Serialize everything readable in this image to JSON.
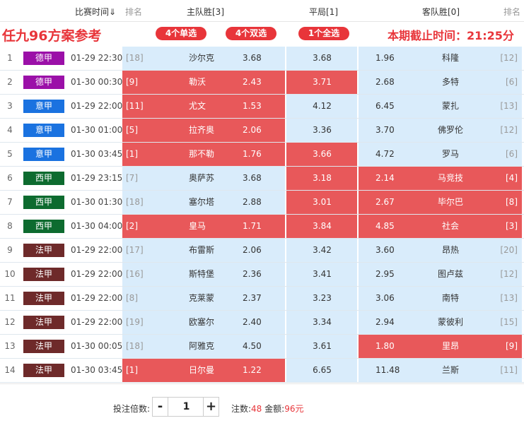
{
  "header": {
    "time_col": "比赛时间⇓",
    "rank_col_left": "排名",
    "home_col": "主队胜[3]",
    "draw_col": "平局[1]",
    "away_col": "客队胜[0]",
    "rank_col_right": "排名"
  },
  "banner": {
    "title": "任九96方案参考",
    "btn_single": "4个单选",
    "btn_double": "4个双选",
    "btn_full": "1个全选",
    "deadline": "本期截止时间：21:25分"
  },
  "colors": {
    "德甲": "#9b10a8",
    "意甲": "#1a72e0",
    "西甲": "#0d6b2f",
    "法甲": "#6e2a2a",
    "selected": "#e8585a",
    "unselected": "#d9ecfb",
    "accent": "#e8353a"
  },
  "matches": [
    {
      "idx": "1",
      "league": "德甲",
      "time": "01-29 22:30",
      "home_rank": "[18]",
      "home": "沙尔克",
      "home_odds": "3.68",
      "draw_odds": "3.68",
      "away_odds": "1.96",
      "away": "科隆",
      "away_rank": "[12]",
      "sel": [
        false,
        false,
        false
      ]
    },
    {
      "idx": "2",
      "league": "德甲",
      "time": "01-30 00:30",
      "home_rank": "[9]",
      "home": "勒沃",
      "home_odds": "2.43",
      "draw_odds": "3.71",
      "away_odds": "2.68",
      "away": "多特",
      "away_rank": "[6]",
      "sel": [
        true,
        true,
        false
      ]
    },
    {
      "idx": "3",
      "league": "意甲",
      "time": "01-29 22:00",
      "home_rank": "[11]",
      "home": "尤文",
      "home_odds": "1.53",
      "draw_odds": "4.12",
      "away_odds": "6.45",
      "away": "蒙扎",
      "away_rank": "[13]",
      "sel": [
        true,
        false,
        false
      ]
    },
    {
      "idx": "4",
      "league": "意甲",
      "time": "01-30 01:00",
      "home_rank": "[5]",
      "home": "拉齐奥",
      "home_odds": "2.06",
      "draw_odds": "3.36",
      "away_odds": "3.70",
      "away": "佛罗伦",
      "away_rank": "[12]",
      "sel": [
        true,
        false,
        false
      ]
    },
    {
      "idx": "5",
      "league": "意甲",
      "time": "01-30 03:45",
      "home_rank": "[1]",
      "home": "那不勒",
      "home_odds": "1.76",
      "draw_odds": "3.66",
      "away_odds": "4.72",
      "away": "罗马",
      "away_rank": "[6]",
      "sel": [
        true,
        true,
        false
      ]
    },
    {
      "idx": "6",
      "league": "西甲",
      "time": "01-29 23:15",
      "home_rank": "[7]",
      "home": "奥萨苏",
      "home_odds": "3.68",
      "draw_odds": "3.18",
      "away_odds": "2.14",
      "away": "马竞技",
      "away_rank": "[4]",
      "sel": [
        false,
        true,
        true
      ]
    },
    {
      "idx": "7",
      "league": "西甲",
      "time": "01-30 01:30",
      "home_rank": "[18]",
      "home": "塞尔塔",
      "home_odds": "2.88",
      "draw_odds": "3.01",
      "away_odds": "2.67",
      "away": "毕尔巴",
      "away_rank": "[8]",
      "sel": [
        false,
        true,
        true
      ]
    },
    {
      "idx": "8",
      "league": "西甲",
      "time": "01-30 04:00",
      "home_rank": "[2]",
      "home": "皇马",
      "home_odds": "1.71",
      "draw_odds": "3.84",
      "away_odds": "4.85",
      "away": "社会",
      "away_rank": "[3]",
      "sel": [
        true,
        true,
        true
      ]
    },
    {
      "idx": "9",
      "league": "法甲",
      "time": "01-29 22:00",
      "home_rank": "[17]",
      "home": "布雷斯",
      "home_odds": "2.06",
      "draw_odds": "3.42",
      "away_odds": "3.60",
      "away": "昂热",
      "away_rank": "[20]",
      "sel": [
        false,
        false,
        false
      ]
    },
    {
      "idx": "10",
      "league": "法甲",
      "time": "01-29 22:00",
      "home_rank": "[16]",
      "home": "斯特堡",
      "home_odds": "2.36",
      "draw_odds": "3.41",
      "away_odds": "2.95",
      "away": "图卢兹",
      "away_rank": "[12]",
      "sel": [
        false,
        false,
        false
      ]
    },
    {
      "idx": "11",
      "league": "法甲",
      "time": "01-29 22:00",
      "home_rank": "[8]",
      "home": "克莱蒙",
      "home_odds": "2.37",
      "draw_odds": "3.23",
      "away_odds": "3.06",
      "away": "南特",
      "away_rank": "[13]",
      "sel": [
        false,
        false,
        false
      ]
    },
    {
      "idx": "12",
      "league": "法甲",
      "time": "01-29 22:00",
      "home_rank": "[19]",
      "home": "欧塞尔",
      "home_odds": "2.40",
      "draw_odds": "3.34",
      "away_odds": "2.94",
      "away": "蒙彼利",
      "away_rank": "[15]",
      "sel": [
        false,
        false,
        false
      ]
    },
    {
      "idx": "13",
      "league": "法甲",
      "time": "01-30 00:05",
      "home_rank": "[18]",
      "home": "阿雅克",
      "home_odds": "4.50",
      "draw_odds": "3.61",
      "away_odds": "1.80",
      "away": "里昂",
      "away_rank": "[9]",
      "sel": [
        false,
        false,
        true
      ]
    },
    {
      "idx": "14",
      "league": "法甲",
      "time": "01-30 03:45",
      "home_rank": "[1]",
      "home": "日尔曼",
      "home_odds": "1.22",
      "draw_odds": "6.65",
      "away_odds": "11.48",
      "away": "兰斯",
      "away_rank": "[11]",
      "sel": [
        true,
        false,
        false
      ]
    }
  ],
  "footer": {
    "multiplier_label": "投注倍数:",
    "minus": "-",
    "plus": "+",
    "multiplier_value": "1",
    "bets_label": "注数:",
    "bets_value": "48",
    "amount_label": "金额:",
    "amount_value": "96元"
  }
}
